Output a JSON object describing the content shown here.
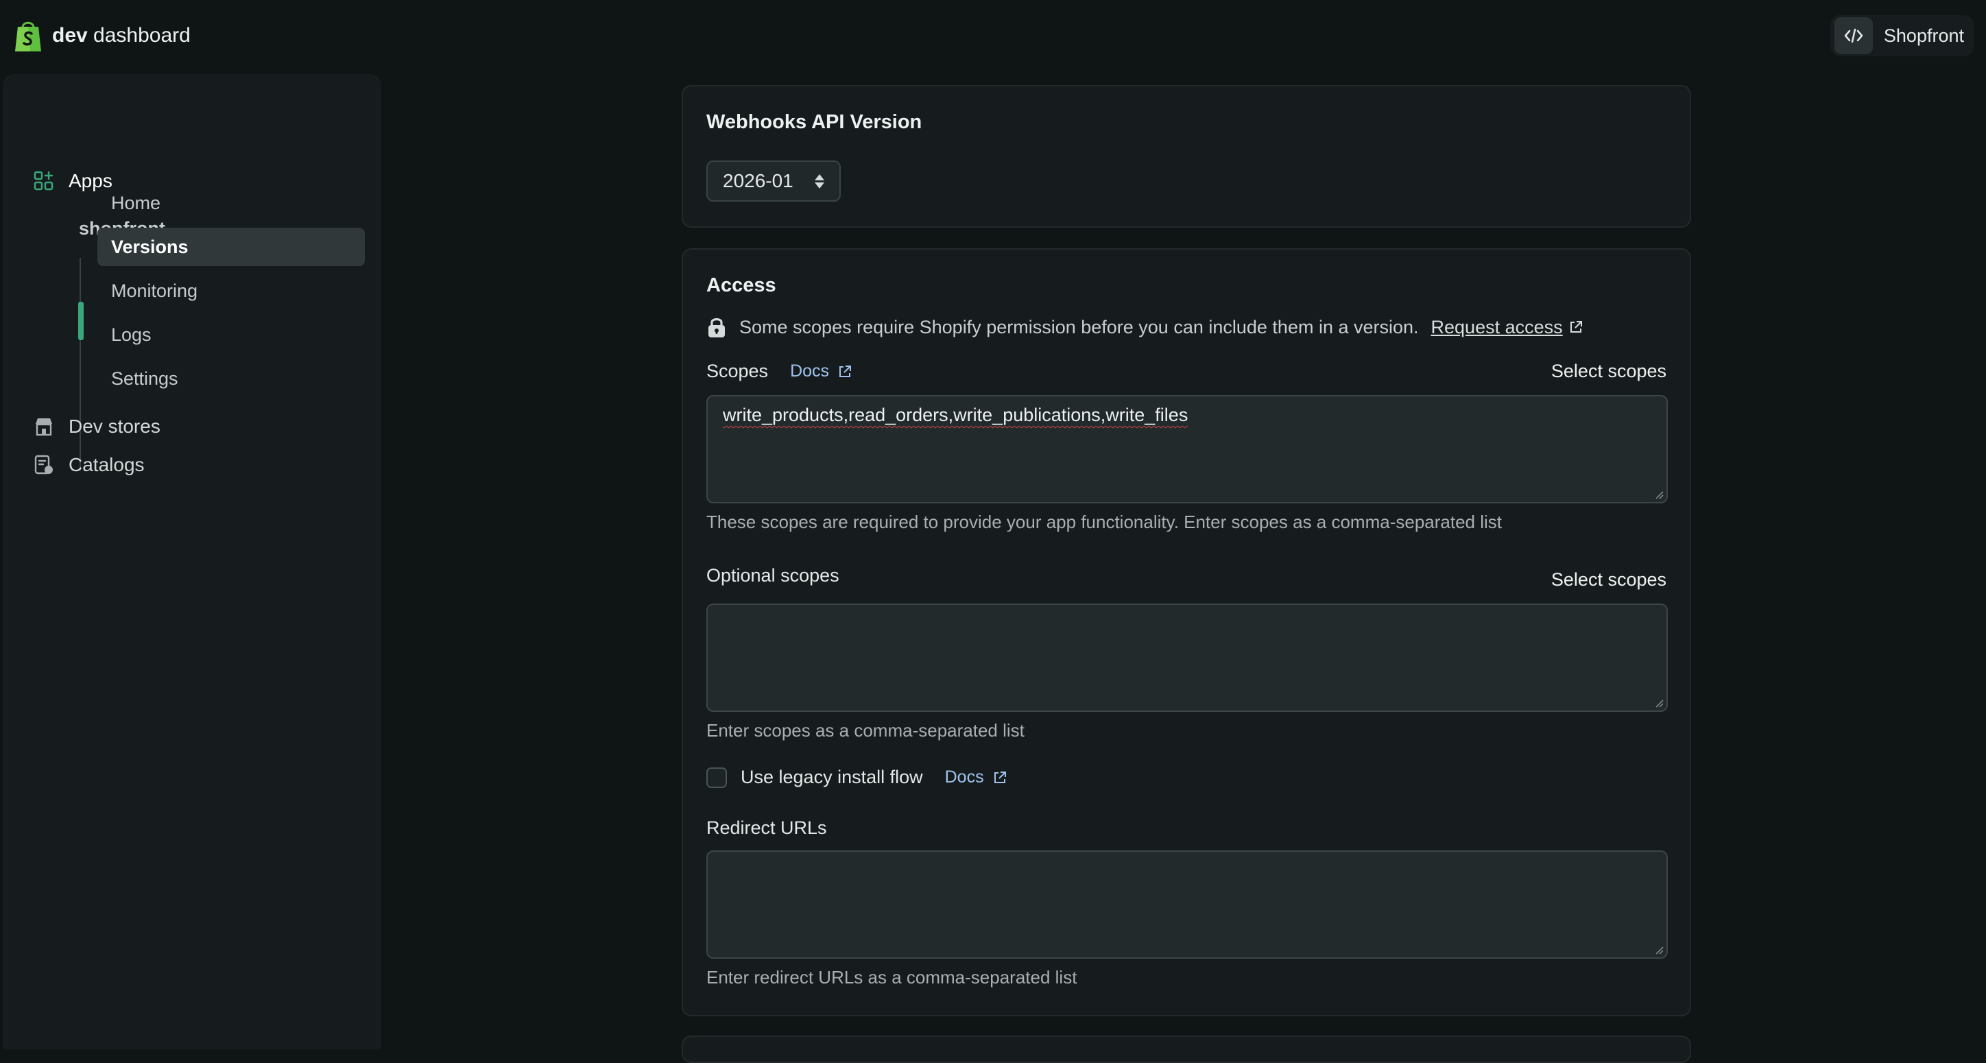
{
  "header": {
    "brand_bold": "dev",
    "brand_rest": "dashboard",
    "store_label": "Shopfront"
  },
  "sidebar": {
    "apps_label": "Apps",
    "app_name": "shopfront",
    "subnav": [
      {
        "label": "Home"
      },
      {
        "label": "Versions"
      },
      {
        "label": "Monitoring"
      },
      {
        "label": "Logs"
      },
      {
        "label": "Settings"
      }
    ],
    "active_subnav": "Versions",
    "dev_stores_label": "Dev stores",
    "catalogs_label": "Catalogs"
  },
  "webhooks": {
    "title": "Webhooks API Version",
    "selected_version": "2026-01"
  },
  "access": {
    "title": "Access",
    "notice": "Some scopes require Shopify permission before you can include them in a version.",
    "request_access_label": "Request access",
    "scopes_label": "Scopes",
    "docs_label": "Docs",
    "select_scopes_label": "Select scopes",
    "scopes_value": "write_products,read_orders,write_publications,write_files",
    "scopes_help": "These scopes are required to provide your app functionality. Enter scopes as a comma-separated list",
    "optional_scopes_label": "Optional scopes",
    "optional_select_scopes_label": "Select scopes",
    "optional_scopes_value": "",
    "optional_scopes_help": "Enter scopes as a comma-separated list",
    "legacy_install_label": "Use legacy install flow",
    "legacy_docs_label": "Docs",
    "legacy_install_checked": false,
    "redirect_urls_label": "Redirect URLs",
    "redirect_urls_value": "",
    "redirect_urls_help": "Enter redirect URLs as a comma-separated list"
  },
  "colors": {
    "background": "#0f1414",
    "panel": "#161c1d",
    "accent_green": "#3aa77a",
    "link_blue": "#9fc3ee"
  }
}
